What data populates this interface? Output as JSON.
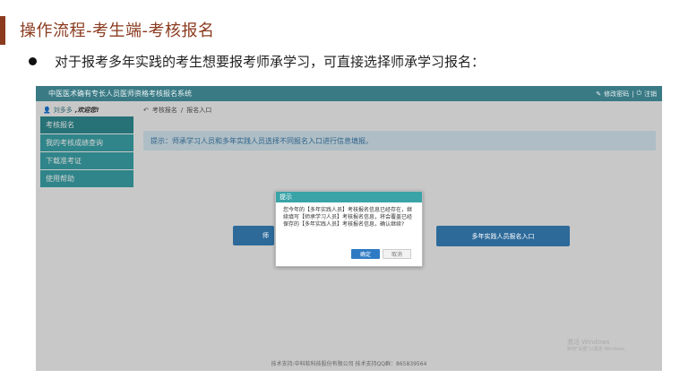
{
  "slide": {
    "title": "操作流程-考生端-考核报名",
    "bullet": "对于报考多年实践的考生想要报考师承学习，可直接选择师承学习报名："
  },
  "app": {
    "title": "中医医术确有专长人员医师资格考核报名系统",
    "topbar_links": [
      "修改密码",
      "|",
      "注销"
    ],
    "user": {
      "name": "刘多多",
      "greeting": ",欢迎您!"
    },
    "sidebar": {
      "items": [
        {
          "label": "考核报名",
          "active": true
        },
        {
          "label": "我的考核成绩查询",
          "active": false
        },
        {
          "label": "下载准考证",
          "active": false
        },
        {
          "label": "使用帮助",
          "active": false
        }
      ]
    },
    "breadcrumb": [
      "考核报名",
      "/",
      "报名入口"
    ],
    "notice": "提示：师承学习人员和多年实践人员选择不同报名入口进行信息填报。",
    "entry_buttons": {
      "left": "师",
      "right": "多年实践人员报名入口"
    },
    "dialog": {
      "title": "提示",
      "message": "您今年的【多年实践人员】考核报名信息已经存在，继续填写【师承学习人员】考核报名信息，将会覆盖已经保存的【多年实践人员】考核报名信息，确认继续?",
      "ok": "确定",
      "cancel": "取消"
    },
    "watermark": {
      "line1": "激活 Windows",
      "line2": "转到\"设置\"以激活 Windows。"
    },
    "footer": "技术支持:中科软科技股份有限公司 技术支持QQ群：865839564"
  },
  "colors": {
    "accent_title": "#8b3a1e",
    "topbar": "#3a7a85",
    "sidebar": "#3aa3a8",
    "button": "#2d6a9a",
    "ok_button": "#2e7bc4"
  }
}
